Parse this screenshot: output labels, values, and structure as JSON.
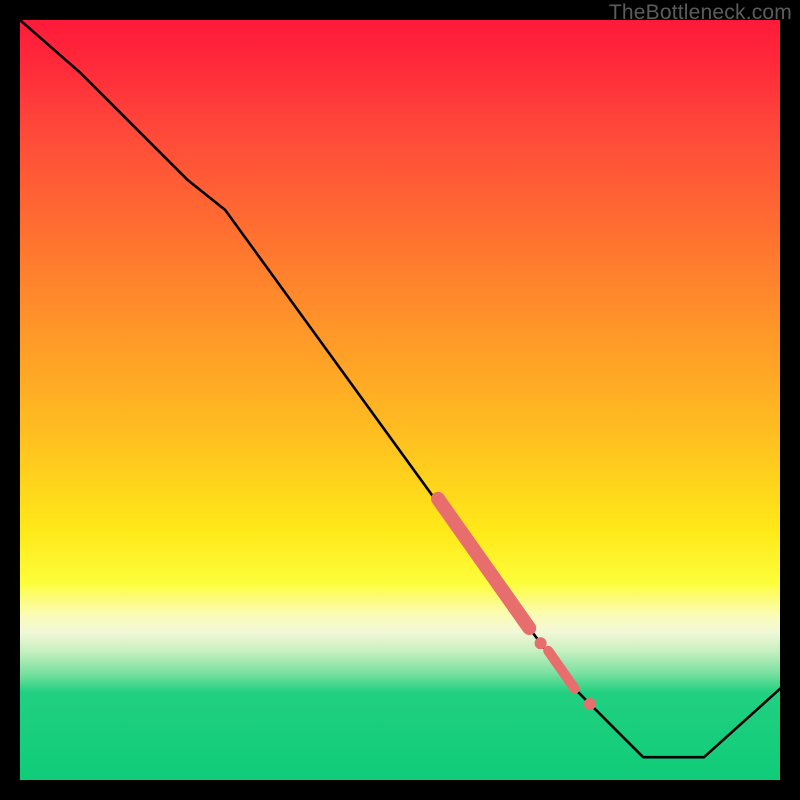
{
  "watermark": "TheBottleneck.com",
  "chart_data": {
    "type": "line",
    "title": "",
    "xlabel": "",
    "ylabel": "",
    "xlim": [
      0,
      100
    ],
    "ylim": [
      0,
      100
    ],
    "background_gradient": "red-yellow-green vertical heatmap",
    "series": [
      {
        "name": "curve",
        "color": "#000000",
        "x": [
          0,
          8,
          22,
          27,
          64,
          73,
          82,
          90,
          100
        ],
        "values": [
          100,
          93,
          79,
          75,
          24,
          12,
          3,
          3,
          12
        ]
      }
    ],
    "highlights": [
      {
        "name": "thick-salmon-segment",
        "color": "#e86d6d",
        "thickness": "thick",
        "x_range": [
          55,
          67
        ],
        "y_range": [
          37,
          20
        ]
      },
      {
        "name": "salmon-dot-upper",
        "color": "#e86d6d",
        "x": 68.5,
        "y": 18
      },
      {
        "name": "salmon-segment-mid",
        "color": "#e86d6d",
        "thickness": "medium",
        "x_range": [
          69.5,
          73
        ],
        "y_range": [
          17,
          12
        ]
      },
      {
        "name": "salmon-dot-lower",
        "color": "#e86d6d",
        "x": 75,
        "y": 10
      }
    ]
  }
}
